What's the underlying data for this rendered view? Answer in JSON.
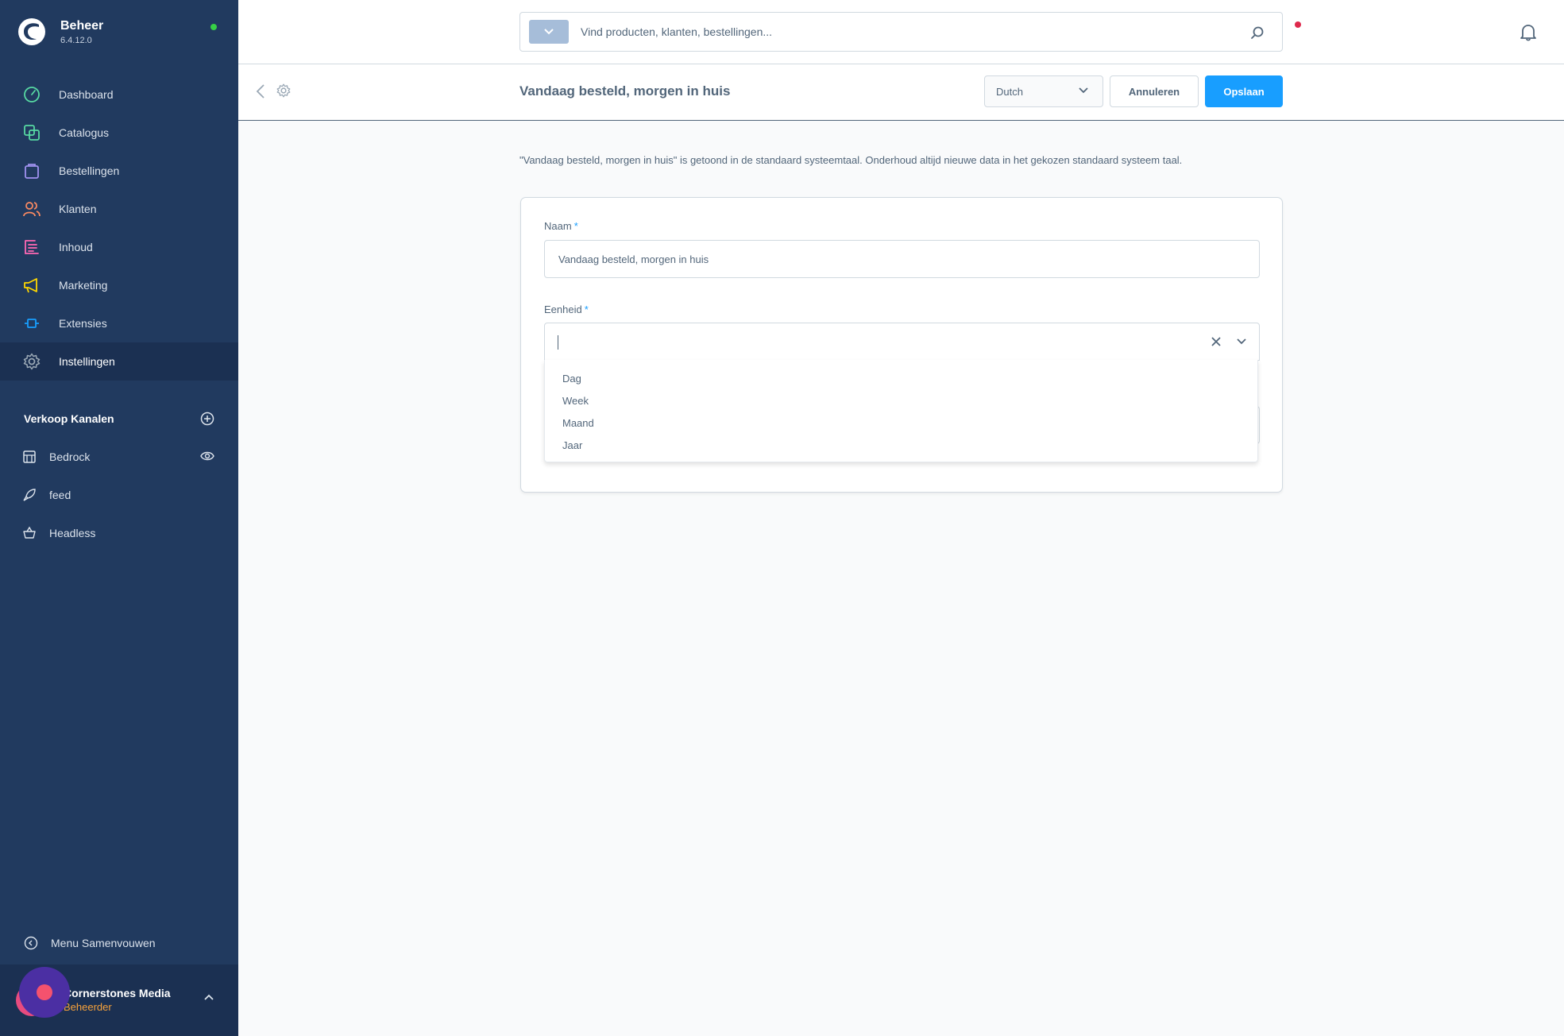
{
  "app": {
    "title": "Beheer",
    "version": "6.4.12.0"
  },
  "sidebar": {
    "items": [
      {
        "label": "Dashboard",
        "icon": "dashboard-icon",
        "color": "#57d9a3"
      },
      {
        "label": "Catalogus",
        "icon": "catalog-icon",
        "color": "#57d9a3"
      },
      {
        "label": "Bestellingen",
        "icon": "orders-icon",
        "color": "#a092f0"
      },
      {
        "label": "Klanten",
        "icon": "customers-icon",
        "color": "#f88962"
      },
      {
        "label": "Inhoud",
        "icon": "content-icon",
        "color": "#ff68b4"
      },
      {
        "label": "Marketing",
        "icon": "marketing-icon",
        "color": "#ffd700"
      },
      {
        "label": "Extensies",
        "icon": "extensions-icon",
        "color": "#189eff"
      },
      {
        "label": "Instellingen",
        "icon": "settings-icon",
        "color": "#9aa8b5"
      }
    ],
    "active_item": "Instellingen",
    "channels_title": "Verkoop Kanalen",
    "channels": [
      {
        "label": "Bedrock",
        "icon": "storefront-icon"
      },
      {
        "label": "feed",
        "icon": "rocket-icon"
      },
      {
        "label": "Headless",
        "icon": "basket-icon"
      }
    ],
    "collapse_label": "Menu Samenvouwen",
    "user": {
      "name": "Cornerstones Media",
      "role": "Beheerder"
    }
  },
  "search": {
    "placeholder": "Vind producten, klanten, bestellingen..."
  },
  "smartbar": {
    "title": "Vandaag besteld, morgen in huis",
    "language": "Dutch",
    "cancel_label": "Annuleren",
    "save_label": "Opslaan"
  },
  "notice": "\"Vandaag besteld, morgen in huis\" is getoond in de standaard systeemtaal. Onderhoud altijd nieuwe data in het gekozen standaard systeem taal.",
  "form": {
    "name_label": "Naam",
    "name_value": "Vandaag besteld, morgen in huis",
    "unit_label": "Eenheid",
    "required_mark": "*",
    "unit_options": [
      "Dag",
      "Week",
      "Maand",
      "Jaar"
    ]
  },
  "colors": {
    "sidebar_bg": "#213a5f",
    "accent": "#189eff",
    "status_online": "#37d046",
    "user_role": "#f7a23b"
  }
}
